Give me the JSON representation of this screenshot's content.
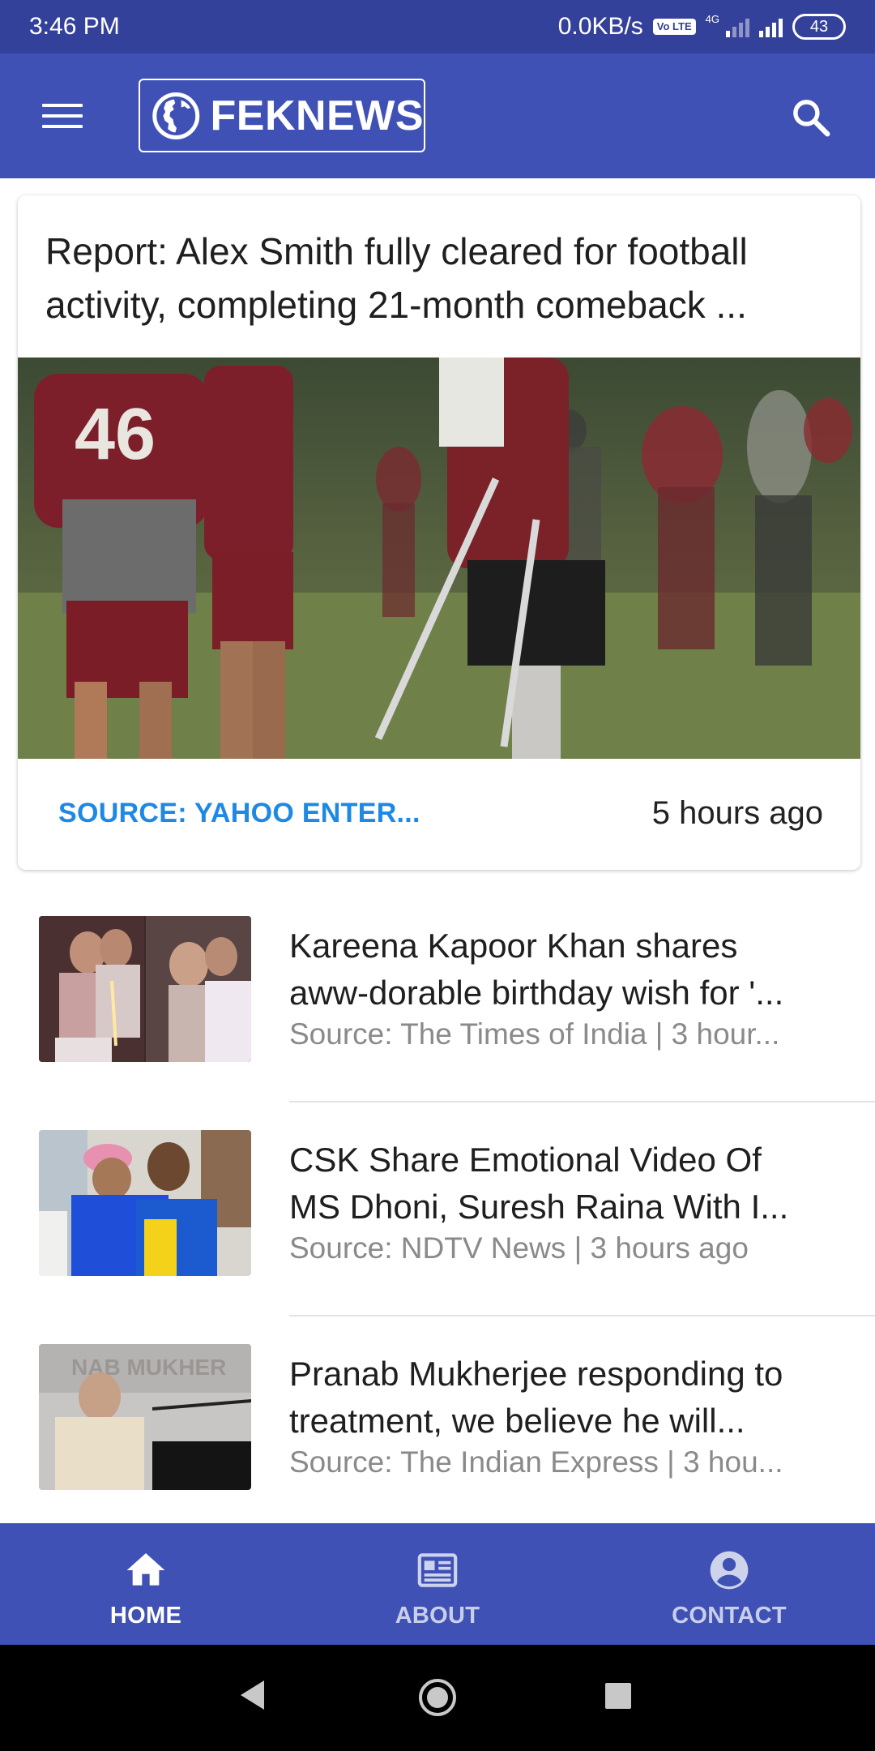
{
  "status_bar": {
    "time": "3:46 PM",
    "net_speed": "0.0KB/s",
    "volte_badge": "Vo LTE",
    "network_type": "4G",
    "battery": "43"
  },
  "app_bar": {
    "logo_text": "FEKNEWS",
    "menu_icon": "hamburger-menu-icon",
    "logo_icon": "globe-icon",
    "search_icon": "search-icon",
    "color": "#3f51b5"
  },
  "featured": {
    "title": "Report: Alex Smith fully cleared for football activity, completing 21-month comeback ...",
    "source": "SOURCE: YAHOO ENTER...",
    "time": "5 hours ago",
    "source_color": "#1e88e5"
  },
  "news_items": [
    {
      "title": "Kareena Kapoor Khan shares aww-dorable birthday wish for '...",
      "meta": "Source: The Times of India | 3 hour..."
    },
    {
      "title": "CSK Share Emotional Video Of MS Dhoni, Suresh Raina With I...",
      "meta": "Source: NDTV News | 3 hours ago"
    },
    {
      "title": "Pranab Mukherjee responding to treatment, we believe he will...",
      "meta": "Source: The Indian Express | 3 hou..."
    }
  ],
  "bottom_nav": {
    "items": [
      {
        "label": "HOME",
        "icon": "home-icon",
        "active": true
      },
      {
        "label": "ABOUT",
        "icon": "newspaper-icon",
        "active": false
      },
      {
        "label": "CONTACT",
        "icon": "account-circle-icon",
        "active": false
      }
    ]
  },
  "system_nav": {
    "back_icon": "back-triangle-icon",
    "home_icon": "home-circle-icon",
    "recents_icon": "recents-square-icon"
  }
}
